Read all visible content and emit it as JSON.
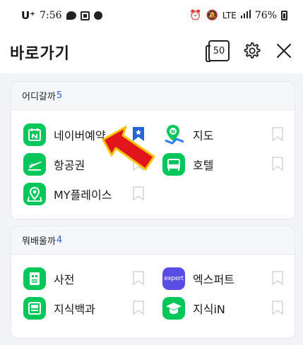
{
  "status_bar": {
    "carrier": "U⁺",
    "time": "7:56",
    "network": "LTE",
    "battery": "76%"
  },
  "header": {
    "title": "바로가기",
    "tab_count": "50"
  },
  "sections": [
    {
      "title": "어디갈까",
      "count": "5",
      "items": [
        {
          "label": "네이버예약",
          "icon": "naver-booking-icon",
          "color": "#03c75a",
          "bookmarked": true
        },
        {
          "label": "지도",
          "icon": "map-icon",
          "color": "#ffffff",
          "bookmarked": false
        },
        {
          "label": "항공권",
          "icon": "airplane-icon",
          "color": "#03c75a",
          "bookmarked": false
        },
        {
          "label": "호텔",
          "icon": "bed-icon",
          "color": "#03c75a",
          "bookmarked": false
        },
        {
          "label": "MY플레이스",
          "icon": "location-icon",
          "color": "#03c75a",
          "bookmarked": false
        }
      ]
    },
    {
      "title": "뭐배울까",
      "count": "4",
      "items": [
        {
          "label": "사전",
          "icon": "dictionary-icon",
          "color": "#03c75a",
          "bookmarked": false
        },
        {
          "label": "엑스퍼트",
          "icon": "expert-icon",
          "icon_text": "expert",
          "color": "#5a4de6",
          "bookmarked": false
        },
        {
          "label": "지식백과",
          "icon": "encyclopedia-icon",
          "color": "#03c75a",
          "bookmarked": false
        },
        {
          "label": "지식iN",
          "icon": "graduation-cap-icon",
          "color": "#03c75a",
          "bookmarked": false
        }
      ]
    }
  ],
  "colors": {
    "accent": "#2a63d6",
    "naver_green": "#03c75a",
    "pointer_red": "#e2141c",
    "pointer_outline": "#f7c300"
  }
}
